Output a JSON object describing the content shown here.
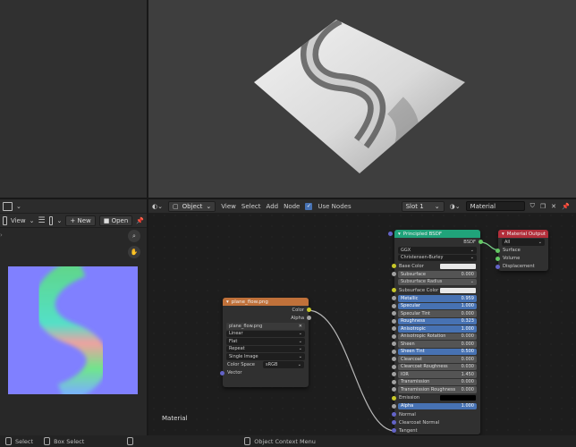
{
  "image_editor": {
    "view_label": "View",
    "new_label": "New",
    "open_label": "Open"
  },
  "node_editor": {
    "object_mode": "Object",
    "menus": [
      "View",
      "Select",
      "Add",
      "Node"
    ],
    "use_nodes_label": "Use Nodes",
    "slot_label": "Slot 1",
    "material_name": "Material",
    "area_label": "Material"
  },
  "image_node": {
    "title": "plane_flow.png",
    "outputs": [
      "Color",
      "Alpha"
    ],
    "image_name": "plane_flow.png",
    "interpolation": "Linear",
    "projection": "Flat",
    "extension": "Repeat",
    "source": "Single Image",
    "color_space_label": "Color Space",
    "color_space_value": "sRGB",
    "input": "Vector"
  },
  "bsdf_node": {
    "title": "Principled BSDF",
    "output": "BSDF",
    "distribution": "GGX",
    "subsurface_method": "Christensen-Burley",
    "base_color_label": "Base Color",
    "subsurface_radius_label": "Subsurface Radius",
    "subsurface_color_label": "Subsurface Color",
    "sliders_a": [
      {
        "label": "Subsurface",
        "value": "0.000"
      }
    ],
    "sliders_b": [
      {
        "label": "Metallic",
        "value": "0.959",
        "blue": true
      },
      {
        "label": "Specular",
        "value": "1.000",
        "blue": true
      },
      {
        "label": "Specular Tint",
        "value": "0.000",
        "blue": false
      },
      {
        "label": "Roughness",
        "value": "0.323",
        "blue": true
      },
      {
        "label": "Anisotropic",
        "value": "1.000",
        "blue": true
      },
      {
        "label": "Anisotropic Rotation",
        "value": "0.000",
        "blue": false
      },
      {
        "label": "Sheen",
        "value": "0.000",
        "blue": false
      },
      {
        "label": "Sheen Tint",
        "value": "0.500",
        "blue": true
      },
      {
        "label": "Clearcoat",
        "value": "0.000",
        "blue": false
      },
      {
        "label": "Clearcoat Roughness",
        "value": "0.030",
        "blue": false
      },
      {
        "label": "IOR",
        "value": "1.450",
        "blue": false
      },
      {
        "label": "Transmission",
        "value": "0.000",
        "blue": false
      },
      {
        "label": "Transmission Roughness",
        "value": "0.000",
        "blue": false
      }
    ],
    "emission_label": "Emission",
    "alpha_label": "Alpha",
    "alpha_value": "1.000",
    "inputs_tail": [
      "Normal",
      "Clearcoat Normal",
      "Tangent"
    ]
  },
  "output_node": {
    "title": "Material Output",
    "target": "All",
    "inputs": [
      "Surface",
      "Volume",
      "Displacement"
    ]
  },
  "status_bar": {
    "select": "Select",
    "box_select": "Box Select",
    "context_menu": "Object Context Menu"
  },
  "colors": {
    "image_header": "#c0713a",
    "bsdf_header": "#20a37a",
    "output_header": "#b22e3a",
    "accent_blue": "#4772b3"
  }
}
